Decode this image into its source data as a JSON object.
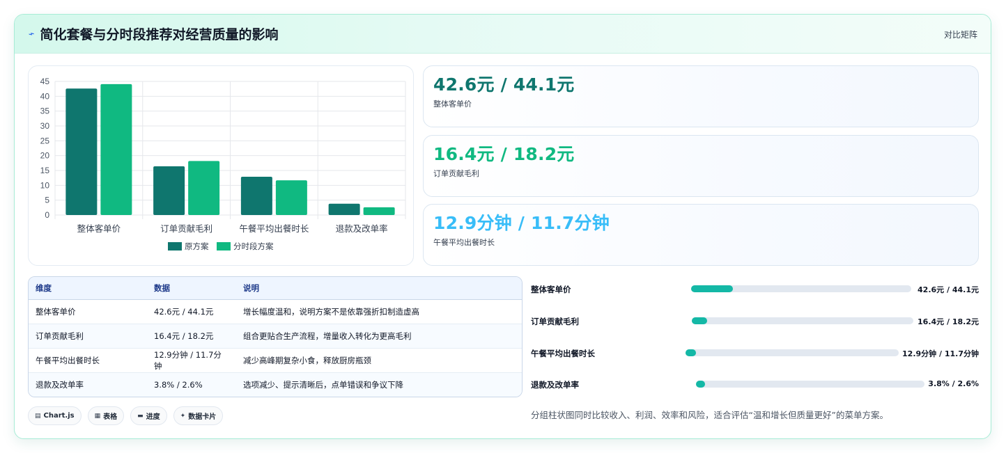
{
  "header": {
    "title": "简化套餐与分时段推荐对经营质量的影响",
    "title_icon": "lightning-icon",
    "tag": "对比矩阵"
  },
  "chart_data": {
    "type": "bar",
    "categories": [
      "整体客单价",
      "订单贡献毛利",
      "午餐平均出餐时长",
      "退款及改单率"
    ],
    "series": [
      {
        "name": "原方案",
        "values": [
          42.6,
          16.4,
          12.9,
          3.8
        ],
        "color": "#0f766e"
      },
      {
        "name": "分时段方案",
        "values": [
          44.1,
          18.2,
          11.7,
          2.6
        ],
        "color": "#10b981"
      }
    ],
    "ylim": [
      0,
      45
    ],
    "yticks": [
      0,
      5,
      10,
      15,
      20,
      25,
      30,
      35,
      40,
      45
    ],
    "grid": true,
    "legend": "bottom"
  },
  "kpis": [
    {
      "value": "42.6元 / 44.1元",
      "label": "整体客单价",
      "color": "#0f766e"
    },
    {
      "value": "16.4元 / 18.2元",
      "label": "订单贡献毛利",
      "color": "#10b981"
    },
    {
      "value": "12.9分钟 / 11.7分钟",
      "label": "午餐平均出餐时长",
      "color": "#38bdf8"
    }
  ],
  "table": {
    "headers": [
      "维度",
      "数据",
      "说明"
    ],
    "rows": [
      [
        "整体客单价",
        "42.6元 / 44.1元",
        "增长幅度温和，说明方案不是依靠强折扣制造虚高"
      ],
      [
        "订单贡献毛利",
        "16.4元 / 18.2元",
        "组合更贴合生产流程，增量收入转化为更高毛利"
      ],
      [
        "午餐平均出餐时长",
        "12.9分钟 / 11.7分钟",
        "减少高峰期复杂小食，释放厨房瓶颈"
      ],
      [
        "退款及改单率",
        "3.8% / 2.6%",
        "选项减少、提示清晰后，点单错误和争议下降"
      ]
    ]
  },
  "chips": [
    {
      "icon": "chart-icon",
      "glyph": "▤",
      "label": "Chart.js"
    },
    {
      "icon": "table-icon",
      "glyph": "▦",
      "label": "表格"
    },
    {
      "icon": "progress-icon",
      "glyph": "▬",
      "label": "进度"
    },
    {
      "icon": "sparkle-icon",
      "glyph": "✦",
      "label": "数据卡片"
    }
  ],
  "progress": [
    {
      "label": "整体客单价",
      "value": "42.6元 / 44.1元",
      "fill": 0.19
    },
    {
      "label": "订单贡献毛利",
      "value": "16.4元 / 18.2元",
      "fill": 0.07
    },
    {
      "label": "午餐平均出餐时长",
      "value": "12.9分钟 / 11.7分钟",
      "fill": 0.05
    },
    {
      "label": "退款及改单率",
      "value": "3.8% / 2.6%",
      "fill": 0.04
    }
  ],
  "note": "分组柱状图同时比较收入、利润、效率和风险，适合评估“温和增长但质量更好”的菜单方案。"
}
